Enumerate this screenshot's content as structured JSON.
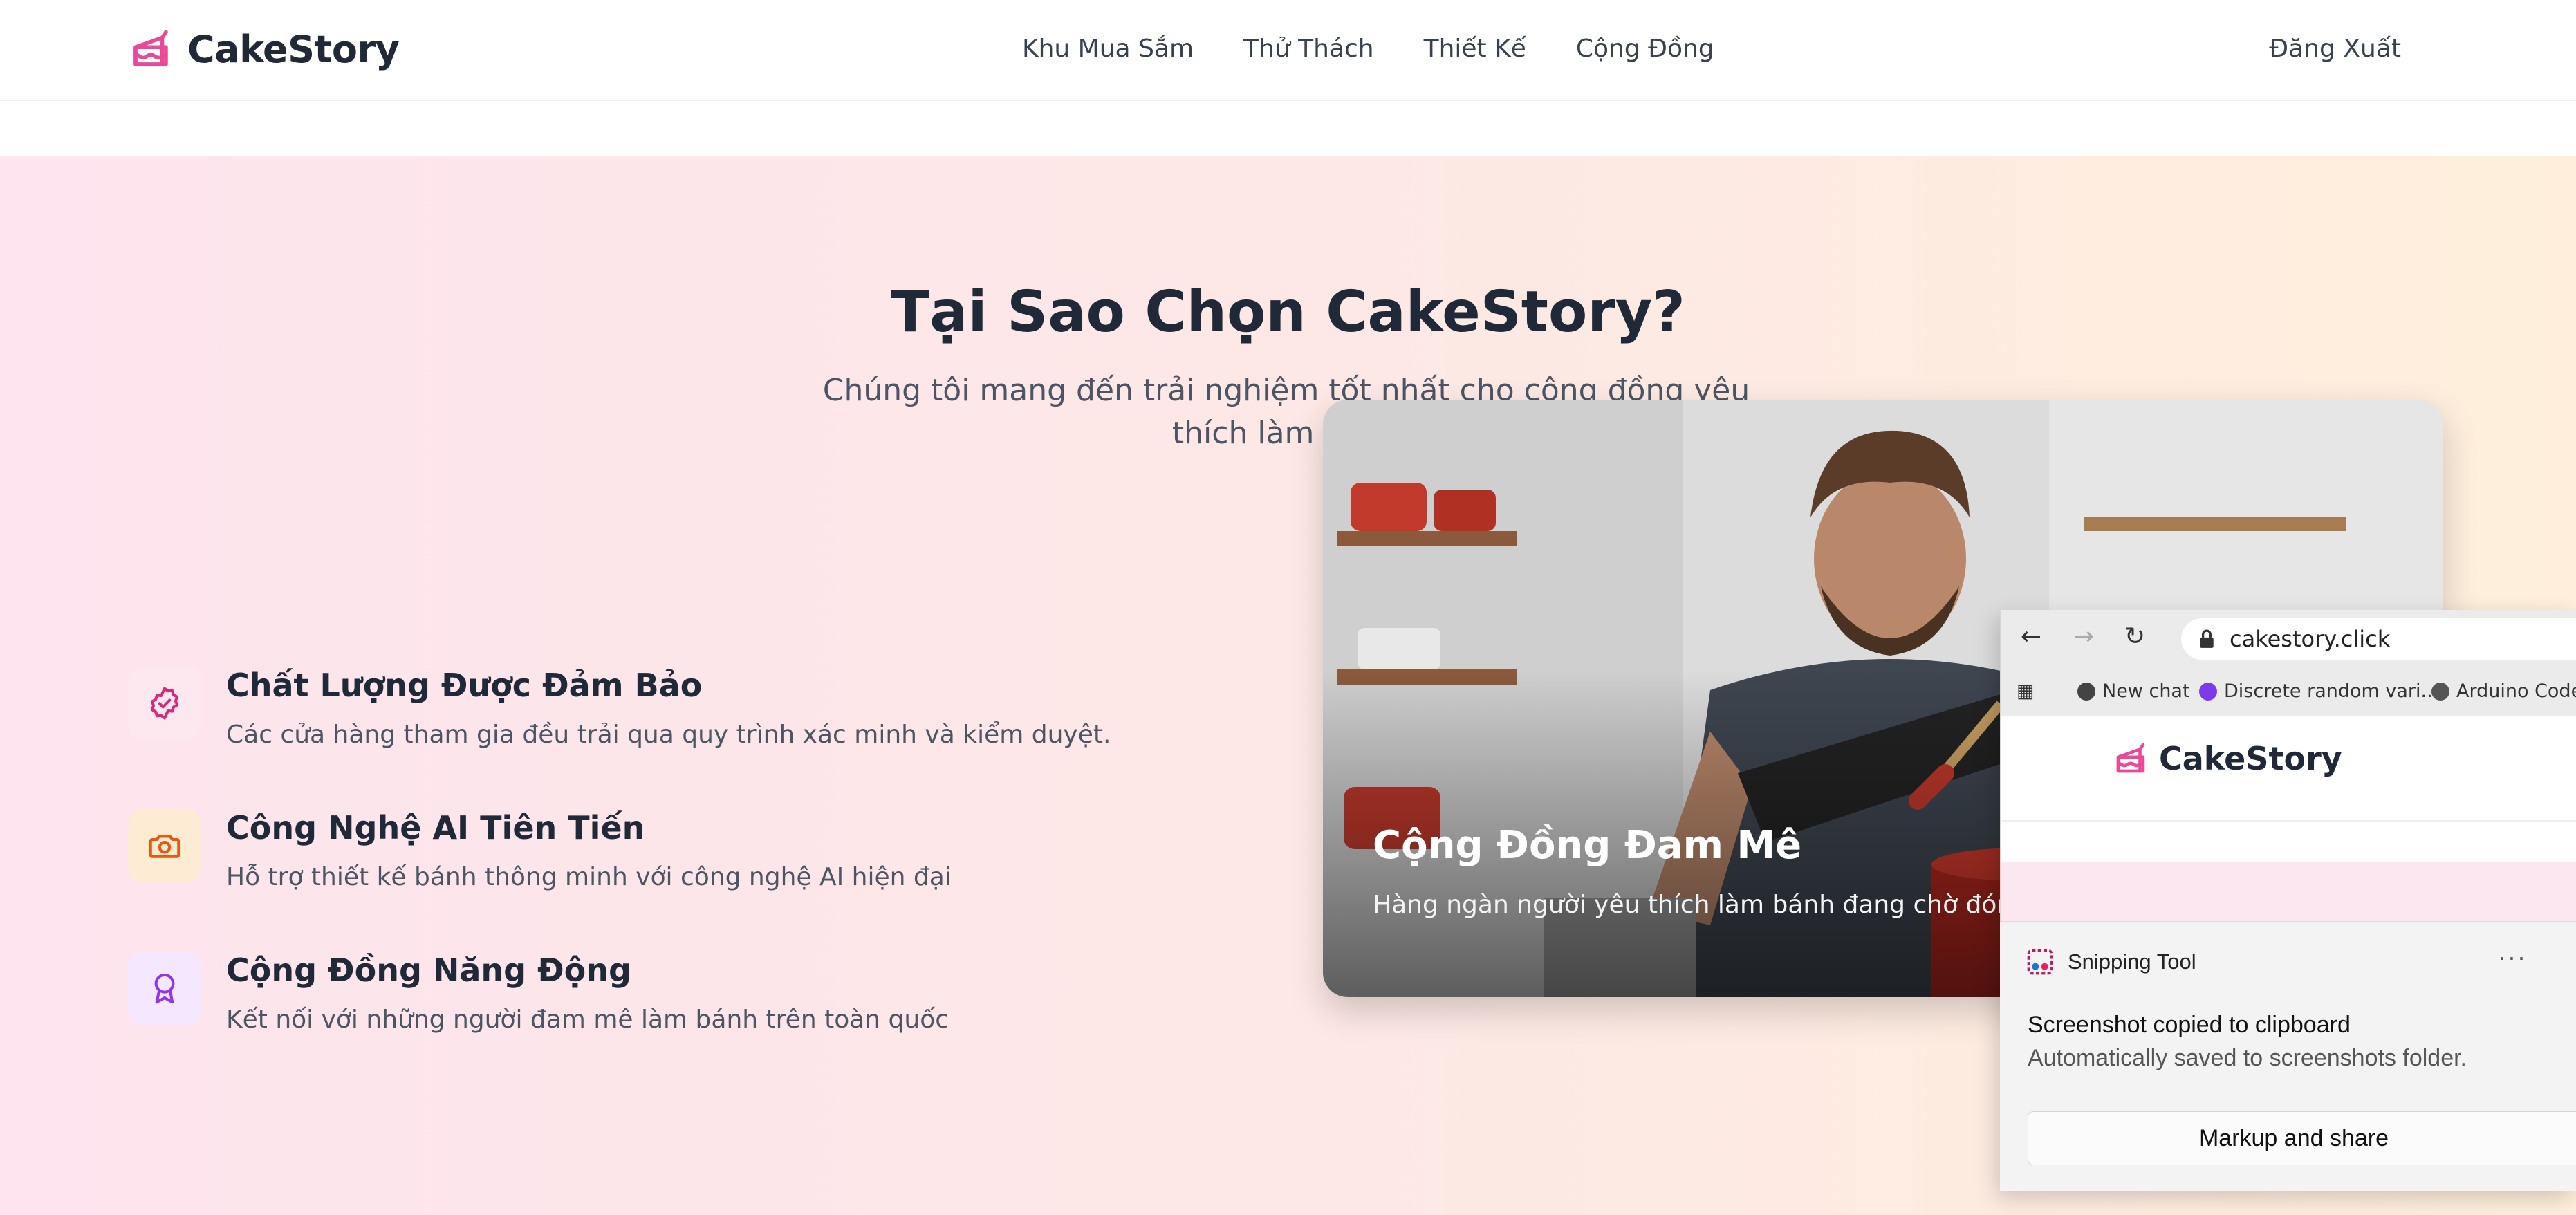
{
  "header": {
    "brand": "CakeStory",
    "nav": [
      "Khu Mua Sắm",
      "Thử Thách",
      "Thiết Kế",
      "Cộng Đồng"
    ],
    "logout_label": "Đăng Xuất"
  },
  "hero": {
    "title": "Tại Sao Chọn CakeStory?",
    "subtitle": "Chúng tôi mang đến trải nghiệm tốt nhất cho cộng đồng yêu thích làm bánh"
  },
  "features": [
    {
      "title": "Chất Lượng Được Đảm Bảo",
      "desc": "Các cửa hàng tham gia đều trải qua quy trình xác minh và kiểm duyệt.",
      "icon": "badge-check-icon"
    },
    {
      "title": "Công Nghệ AI Tiên Tiến",
      "desc": "Hỗ trợ thiết kế bánh thông minh với công nghệ AI hiện đại",
      "icon": "camera-icon"
    },
    {
      "title": "Cộng Đồng Năng Động",
      "desc": "Kết nối với những người đam mê làm bánh trên toàn quốc",
      "icon": "award-icon"
    }
  ],
  "card": {
    "title": "Cộng Đồng Đam Mê",
    "desc": "Hàng ngàn người yêu thích làm bánh đang chờ đón bạn"
  },
  "mini_browser": {
    "url": "cakestory.click",
    "bookmarks": [
      "New chat",
      "Discrete random vari...",
      "Arduino Code"
    ],
    "brand": "CakeStory"
  },
  "toast": {
    "app": "Snipping Tool",
    "message": "Screenshot copied to clipboard",
    "detail": "Automatically saved to screenshots folder.",
    "button": "Markup and share",
    "more": "···"
  },
  "colors": {
    "brand_pink": "#ec4899",
    "feature1_bg": "#fde8ef",
    "feature2_bg": "#feebd3",
    "feature3_bg": "#f3e8ff"
  }
}
